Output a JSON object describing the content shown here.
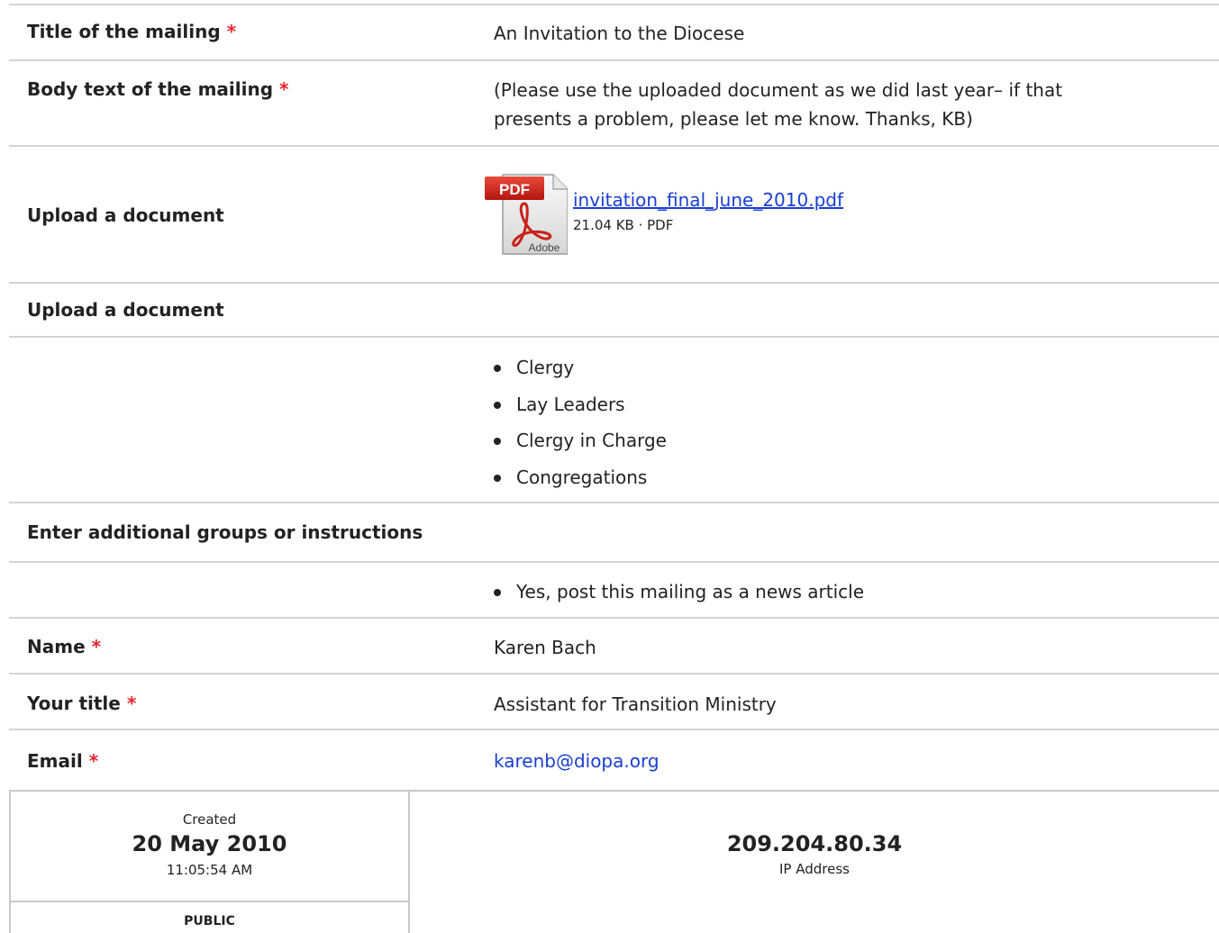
{
  "fields": {
    "title": {
      "label": "Title of the mailing",
      "required_mark": "*",
      "value": "An Invitation to the Diocese"
    },
    "body": {
      "label": "Body text of the mailing",
      "required_mark": "*",
      "value_line1": "(Please use the uploaded document as we did last year– if that",
      "value_line2": "presents a problem, please let me know. Thanks, KB)"
    },
    "upload1": {
      "label": "Upload a document",
      "file_name": "invitation_final_june_2010.pdf",
      "file_meta": "21.04 KB · PDF",
      "icon_text_top": "PDF",
      "icon_text_bottom": "Adobe"
    },
    "upload2": {
      "label": "Upload a document"
    },
    "groups": [
      "Clergy",
      "Lay Leaders",
      "Clergy in Charge",
      "Congregations"
    ],
    "additional": {
      "label": "Enter additional groups or instructions"
    },
    "news_options": [
      "Yes, post this mailing as a news article"
    ],
    "name": {
      "label": "Name",
      "required_mark": "*",
      "value": "Karen Bach"
    },
    "your_title": {
      "label": "Your title",
      "required_mark": "*",
      "value": "Assistant for Transition Ministry"
    },
    "email": {
      "label": "Email",
      "required_mark": "*",
      "value": "karenb@diopa.org"
    }
  },
  "meta": {
    "created_label": "Created",
    "created_date": "20 May 2010",
    "created_time": "11:05:54 AM",
    "ip_value": "209.204.80.34",
    "ip_label": "IP Address",
    "visibility": "PUBLIC"
  },
  "colors": {
    "required": "#e8242b",
    "link": "#1a3fd4",
    "divider": "#d4d4d4"
  }
}
